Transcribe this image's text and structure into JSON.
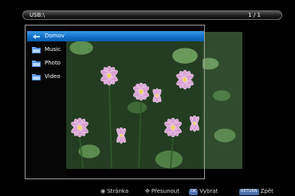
{
  "topbar": {
    "path": "USB:\\",
    "count": "1 / 1"
  },
  "menu": {
    "items": [
      {
        "label": "Domov",
        "icon": "back-icon",
        "selected": true
      },
      {
        "label": "Music",
        "icon": "folder-icon",
        "selected": false
      },
      {
        "label": "Photo",
        "icon": "folder-icon",
        "selected": false
      },
      {
        "label": "Video",
        "icon": "folder-icon",
        "selected": false
      }
    ]
  },
  "hints": {
    "page": "Stránka",
    "move": "Přesunout",
    "ok_key": "OK",
    "select": "Vybrat",
    "return_key": "RETURN",
    "back": "Zpět"
  },
  "colors": {
    "selection": "#1479d4",
    "panel_border": "#9a9a9a"
  }
}
